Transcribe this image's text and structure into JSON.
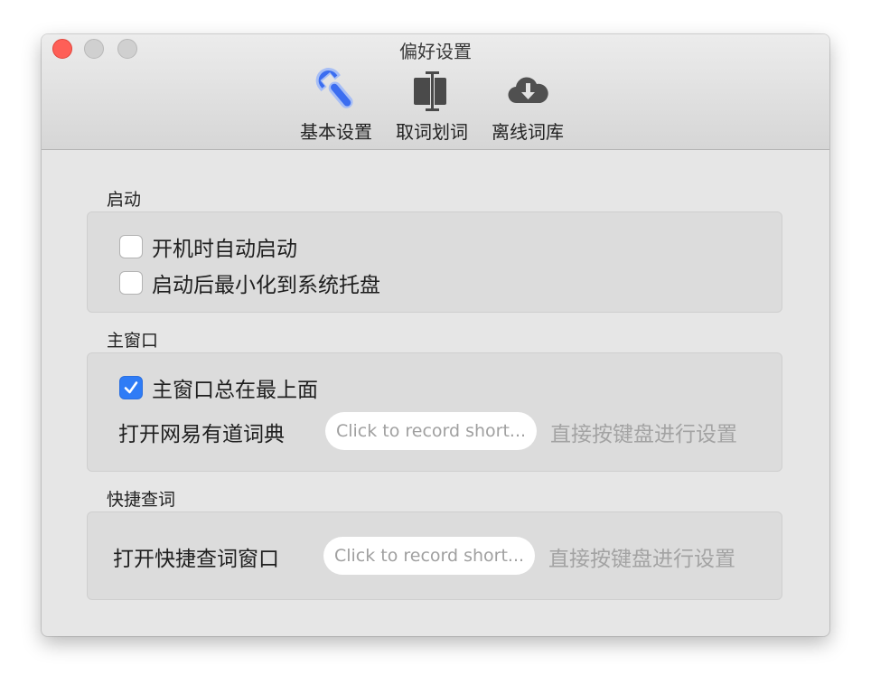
{
  "window": {
    "title": "偏好设置"
  },
  "toolbar": {
    "items": [
      {
        "label": "基本设置",
        "icon": "wrench-icon",
        "selected": true
      },
      {
        "label": "取词划词",
        "icon": "text-cursor-icon",
        "selected": false
      },
      {
        "label": "离线词库",
        "icon": "cloud-download-icon",
        "selected": false
      }
    ]
  },
  "startup": {
    "title": "启动",
    "options": [
      {
        "label": "开机时自动启动",
        "checked": false
      },
      {
        "label": "启动后最小化到系统托盘",
        "checked": false
      }
    ]
  },
  "main_window": {
    "title": "主窗口",
    "always_on_top": {
      "label": "主窗口总在最上面",
      "checked": true
    },
    "hotkey": {
      "label": "打开网易有道词典",
      "placeholder": "Click to record short...",
      "hint": "直接按键盘进行设置"
    }
  },
  "quick_lookup": {
    "title": "快捷查词",
    "hotkey": {
      "label": "打开快捷查词窗口",
      "placeholder": "Click to record short...",
      "hint": "直接按键盘进行设置"
    }
  },
  "colors": {
    "accent": "#2f7cf6",
    "close": "#fe5f57",
    "wrench": "#3b6df0"
  }
}
